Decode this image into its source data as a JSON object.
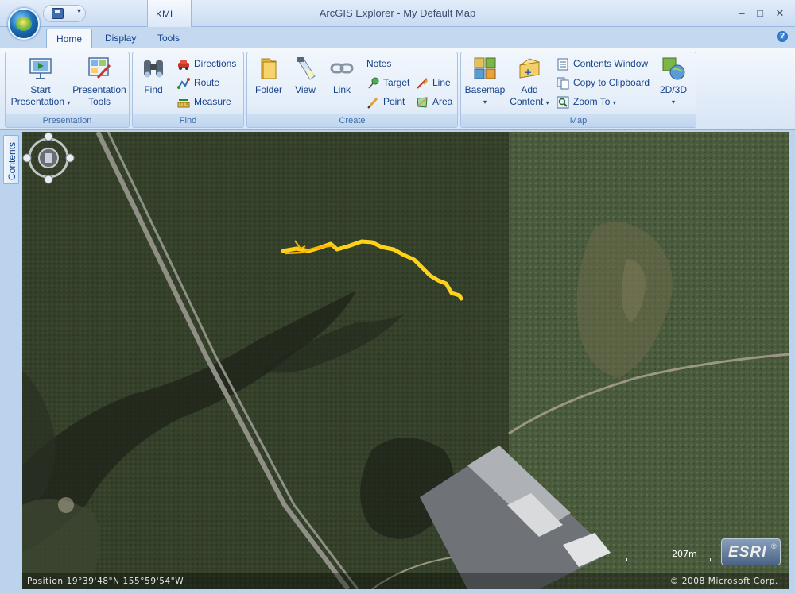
{
  "window": {
    "title": "ArcGIS Explorer - My Default Map",
    "context_tab_group": "KML"
  },
  "tabs": [
    {
      "label": "Home",
      "active": true
    },
    {
      "label": "Display",
      "active": false
    },
    {
      "label": "Tools",
      "active": false
    }
  ],
  "ribbon": {
    "presentation": {
      "label": "Presentation",
      "start_line1": "Start",
      "start_line2": "Presentation",
      "tools_line1": "Presentation",
      "tools_line2": "Tools"
    },
    "find": {
      "label": "Find",
      "find": "Find",
      "directions": "Directions",
      "route": "Route",
      "measure": "Measure"
    },
    "create": {
      "label": "Create",
      "folder": "Folder",
      "view": "View",
      "link": "Link",
      "notes": "Notes",
      "target": "Target",
      "point": "Point",
      "line": "Line",
      "area": "Area"
    },
    "map": {
      "label": "Map",
      "basemap": "Basemap",
      "add_line1": "Add",
      "add_line2": "Content",
      "contents_window": "Contents Window",
      "copy_clipboard": "Copy to Clipboard",
      "zoom_to": "Zoom To",
      "mode": "2D/3D"
    }
  },
  "side_panel": {
    "contents": "Contents"
  },
  "map": {
    "scale": "207m",
    "logo": "ESRI",
    "logo_mark": "®",
    "position": "Position  19°39'48\"N  155°59'54\"W",
    "copyright": "© 2008 Microsoft Corp.",
    "track_color": "#ffd21a"
  }
}
